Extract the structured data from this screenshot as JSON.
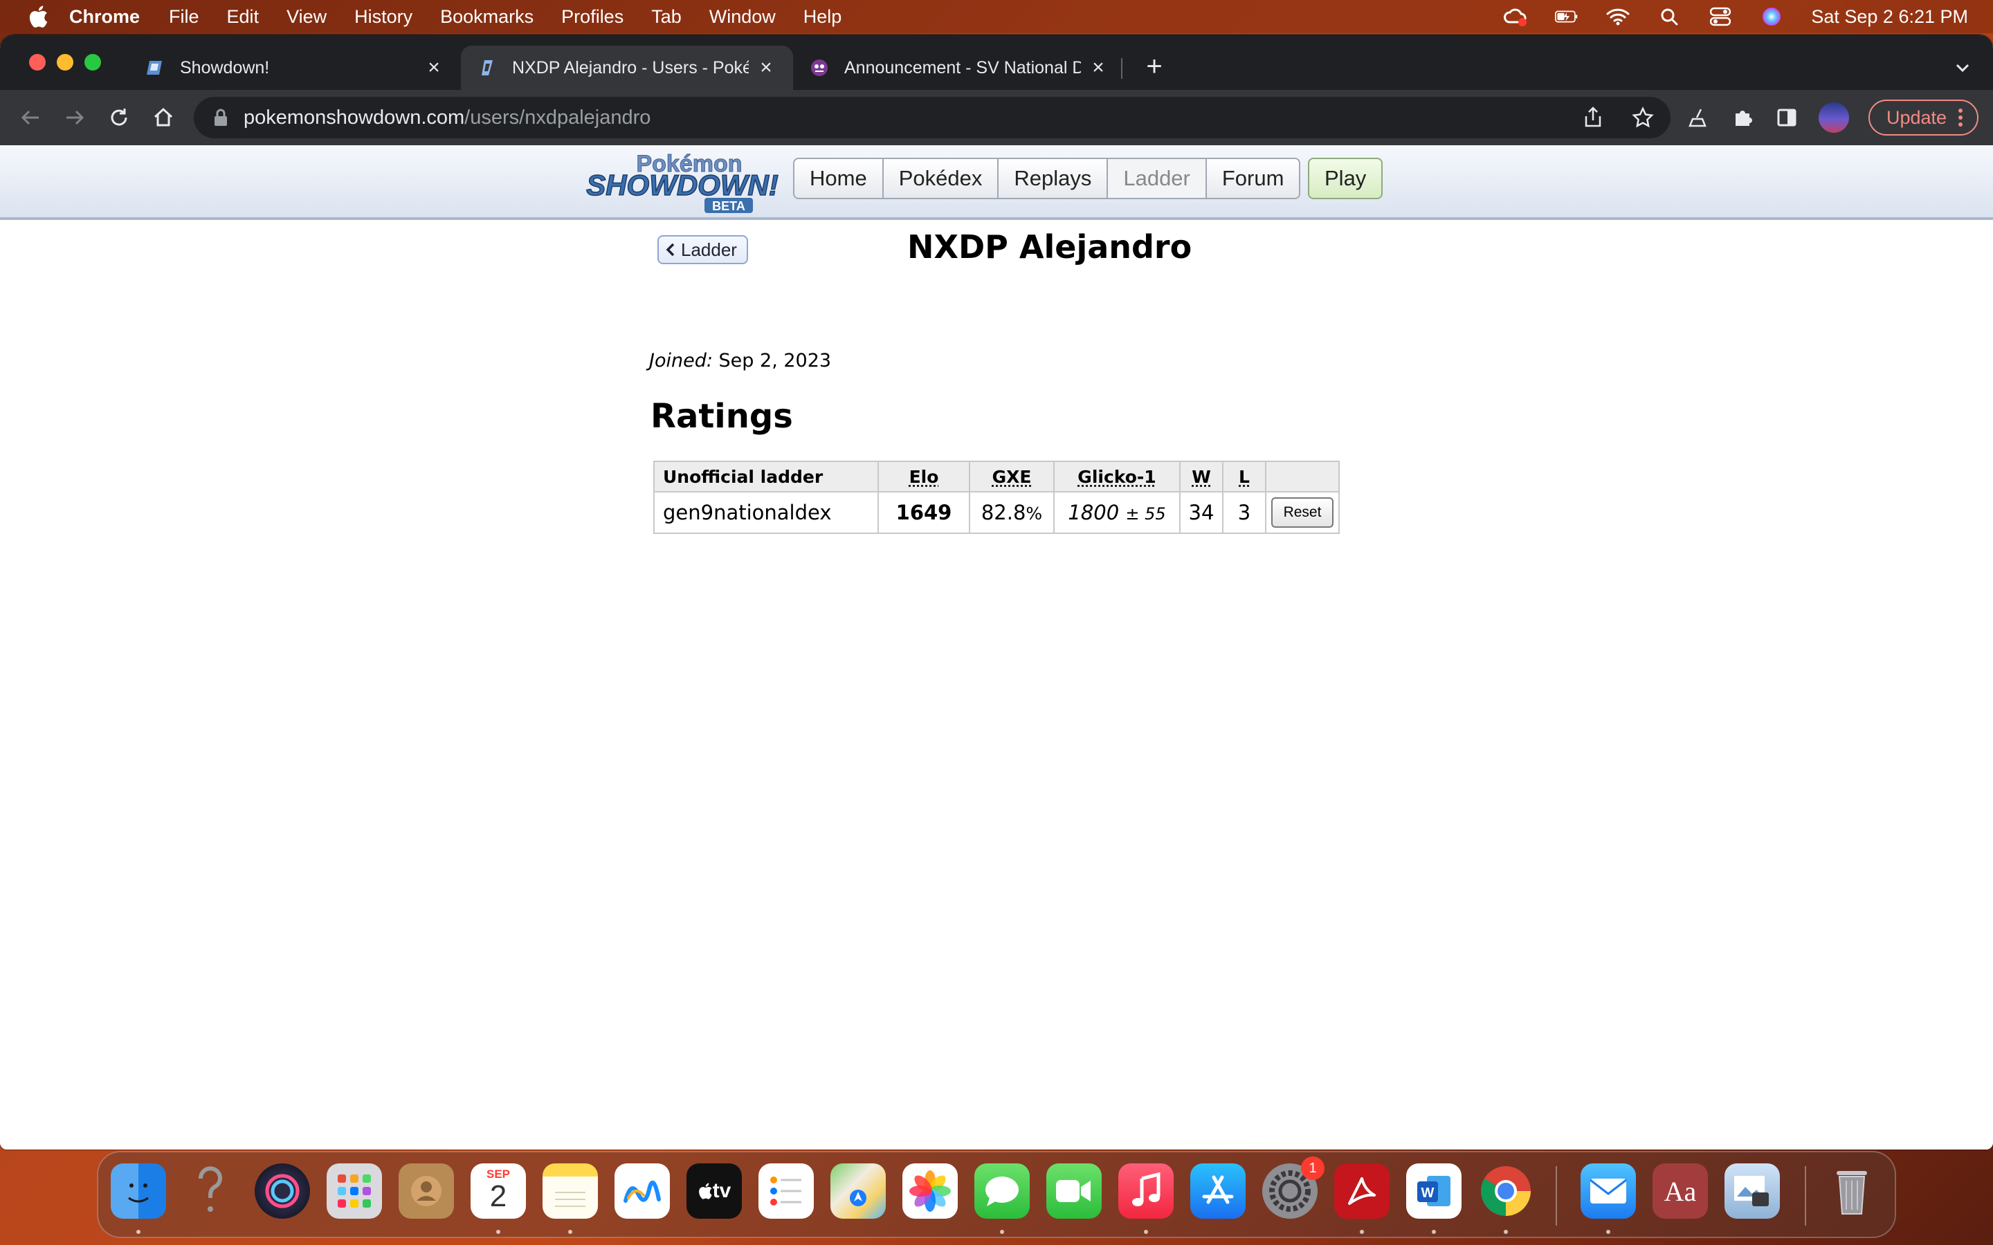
{
  "menubar": {
    "app_name": "Chrome",
    "items": [
      "File",
      "Edit",
      "View",
      "History",
      "Bookmarks",
      "Profiles",
      "Tab",
      "Window",
      "Help"
    ],
    "clock": "Sat Sep 2  6:21 PM"
  },
  "browser": {
    "tabs": [
      {
        "title": "Showdown!"
      },
      {
        "title": "NXDP Alejandro - Users - Poké"
      },
      {
        "title": "Announcement - SV National D"
      }
    ],
    "url_host": "pokemonshowdown.com",
    "url_path": "/users/nxdpalejandro",
    "update_label": "Update"
  },
  "site": {
    "logo_top": "Pokémon",
    "logo_main": "SHOWDOWN!",
    "logo_beta": "BETA",
    "nav": [
      "Home",
      "Pokédex",
      "Replays",
      "Ladder",
      "Forum"
    ],
    "play_label": "Play"
  },
  "profile": {
    "back_label": "Ladder",
    "username": "NXDP Alejandro",
    "joined_label": "Joined:",
    "joined_date": "Sep 2, 2023",
    "ratings_heading": "Ratings",
    "table": {
      "headers": [
        "Unofficial ladder",
        "Elo",
        "GXE",
        "Glicko-1",
        "W",
        "L",
        ""
      ],
      "rows": [
        {
          "format": "gen9nationaldex",
          "elo": "1649",
          "gxe": "82.8",
          "gxe_unit": "%",
          "glicko": "1800",
          "glicko_dev": "± 55",
          "wins": "34",
          "losses": "3",
          "action": "Reset"
        }
      ]
    }
  },
  "dock": {
    "calendar_month": "SEP",
    "calendar_day": "2",
    "tv_label": "tv",
    "dictionary_label": "Aa",
    "settings_badge": "1"
  }
}
